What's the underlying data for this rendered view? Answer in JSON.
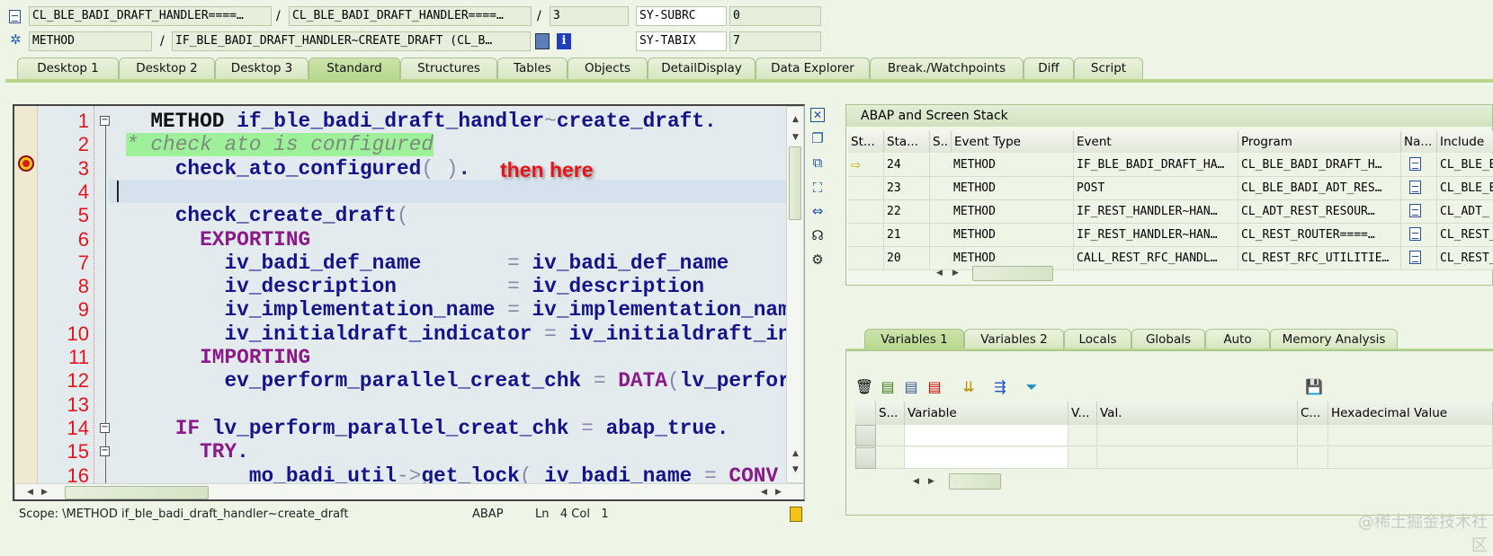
{
  "header": {
    "row1": {
      "field1": "CL_BLE_BADI_DRAFT_HANDLER====…",
      "sep1": "/",
      "field2": "CL_BLE_BADI_DRAFT_HANDLER====…",
      "sep2": "/",
      "field3": "3",
      "sys_label": "SY-SUBRC",
      "sys_value": "0"
    },
    "row2": {
      "field1": "METHOD",
      "sep1": "/",
      "field2": "IF_BLE_BADI_DRAFT_HANDLER~CREATE_DRAFT (CL_B…",
      "sys_label": "SY-TABIX",
      "sys_value": "7"
    }
  },
  "tabs": [
    "Desktop 1",
    "Desktop 2",
    "Desktop 3",
    "Standard",
    "Structures",
    "Tables",
    "Objects",
    "DetailDisplay",
    "Data Explorer",
    "Break./Watchpoints",
    "Diff",
    "Script"
  ],
  "active_tab": "Standard",
  "editor": {
    "lines": [
      [
        {
          "t": "  "
        },
        {
          "t": "METHOD",
          "c": "k"
        },
        {
          "t": " if_ble_badi_draft_handler",
          "c": "id"
        },
        {
          "t": "~",
          "c": "op"
        },
        {
          "t": "create_draft.",
          "c": "id"
        }
      ],
      [
        {
          "t": "* check ato is configured",
          "c": "cm"
        }
      ],
      [
        {
          "t": "    "
        },
        {
          "t": "check_ato_configured",
          "c": "id"
        },
        {
          "t": "( )",
          "c": "op"
        },
        {
          "t": ".",
          "c": "id"
        }
      ],
      [
        {
          "t": ""
        }
      ],
      [
        {
          "t": "    "
        },
        {
          "t": "check_create_draft",
          "c": "id"
        },
        {
          "t": "(",
          "c": "op"
        }
      ],
      [
        {
          "t": "      "
        },
        {
          "t": "EXPORTING",
          "c": "kw"
        }
      ],
      [
        {
          "t": "        "
        },
        {
          "t": "iv_badi_def_name       ",
          "c": "id"
        },
        {
          "t": "=",
          "c": "op"
        },
        {
          "t": " iv_badi_def_name",
          "c": "id"
        }
      ],
      [
        {
          "t": "        "
        },
        {
          "t": "iv_description         ",
          "c": "id"
        },
        {
          "t": "=",
          "c": "op"
        },
        {
          "t": " iv_description",
          "c": "id"
        }
      ],
      [
        {
          "t": "        "
        },
        {
          "t": "iv_implementation_name ",
          "c": "id"
        },
        {
          "t": "=",
          "c": "op"
        },
        {
          "t": " iv_implementation_nam",
          "c": "id"
        }
      ],
      [
        {
          "t": "        "
        },
        {
          "t": "iv_initialdraft_indicator ",
          "c": "id"
        },
        {
          "t": "=",
          "c": "op"
        },
        {
          "t": " iv_initialdraft_in",
          "c": "id"
        }
      ],
      [
        {
          "t": "      "
        },
        {
          "t": "IMPORTING",
          "c": "kw"
        }
      ],
      [
        {
          "t": "        "
        },
        {
          "t": "ev_perform_parallel_creat_chk ",
          "c": "id"
        },
        {
          "t": "=",
          "c": "op"
        },
        {
          "t": " DATA",
          "c": "kw"
        },
        {
          "t": "(",
          "c": "op"
        },
        {
          "t": "lv_perfor",
          "c": "id"
        }
      ],
      [
        {
          "t": ""
        }
      ],
      [
        {
          "t": "    "
        },
        {
          "t": "IF",
          "c": "kw"
        },
        {
          "t": " lv_perform_parallel_creat_chk ",
          "c": "id"
        },
        {
          "t": "=",
          "c": "op"
        },
        {
          "t": " abap_true.",
          "c": "id"
        }
      ],
      [
        {
          "t": "      "
        },
        {
          "t": "TRY",
          "c": "kw"
        },
        {
          "t": ".",
          "c": "id"
        }
      ],
      [
        {
          "t": "          "
        },
        {
          "t": "mo_badi_util",
          "c": "id"
        },
        {
          "t": "->",
          "c": "op"
        },
        {
          "t": "get_lock",
          "c": "id"
        },
        {
          "t": "(",
          "c": "op"
        },
        {
          "t": " iv_badi_name ",
          "c": "id"
        },
        {
          "t": "=",
          "c": "op"
        },
        {
          "t": " CONV",
          "c": "kw"
        }
      ]
    ],
    "current_line": 4,
    "breakpoint_line": 3,
    "annotation": "then here",
    "status": {
      "scope": "Scope: \\METHOD if_ble_badi_draft_handler~create_draft",
      "language": "ABAP",
      "position": "Ln   4 Col   1"
    }
  },
  "stack": {
    "title": "ABAP and Screen Stack",
    "columns": [
      "St...",
      "Sta...",
      "S..",
      "Event Type",
      "Event",
      "Program",
      "Na...",
      "Include"
    ],
    "rows": [
      {
        "current": true,
        "level": "24",
        "event_type": "METHOD",
        "event": "IF_BLE_BADI_DRAFT_HA…",
        "program": "CL_BLE_BADI_DRAFT_H…",
        "include": "CL_BLE_B"
      },
      {
        "current": false,
        "level": "23",
        "event_type": "METHOD",
        "event": "POST",
        "program": "CL_BLE_BADI_ADT_RES…",
        "include": "CL_BLE_B"
      },
      {
        "current": false,
        "level": "22",
        "event_type": "METHOD",
        "event": "IF_REST_HANDLER~HAN…",
        "program": "CL_ADT_REST_RESOUR…",
        "include": "CL_ADT_"
      },
      {
        "current": false,
        "level": "21",
        "event_type": "METHOD",
        "event": "IF_REST_HANDLER~HAN…",
        "program": "CL_REST_ROUTER====…",
        "include": "CL_REST_"
      },
      {
        "current": false,
        "level": "20",
        "event_type": "METHOD",
        "event": "CALL_REST_RFC_HANDL…",
        "program": "CL_REST_RFC_UTILITIE…",
        "include": "CL_REST_"
      }
    ]
  },
  "variables": {
    "tabs": [
      "Variables 1",
      "Variables 2",
      "Locals",
      "Globals",
      "Auto",
      "Memory Analysis"
    ],
    "active_tab": "Variables 1",
    "columns": [
      "S...",
      "Variable",
      "V...",
      "Val.",
      "C...",
      "Hexadecimal Value"
    ]
  },
  "watermark": "@稀土掘金技术社区"
}
